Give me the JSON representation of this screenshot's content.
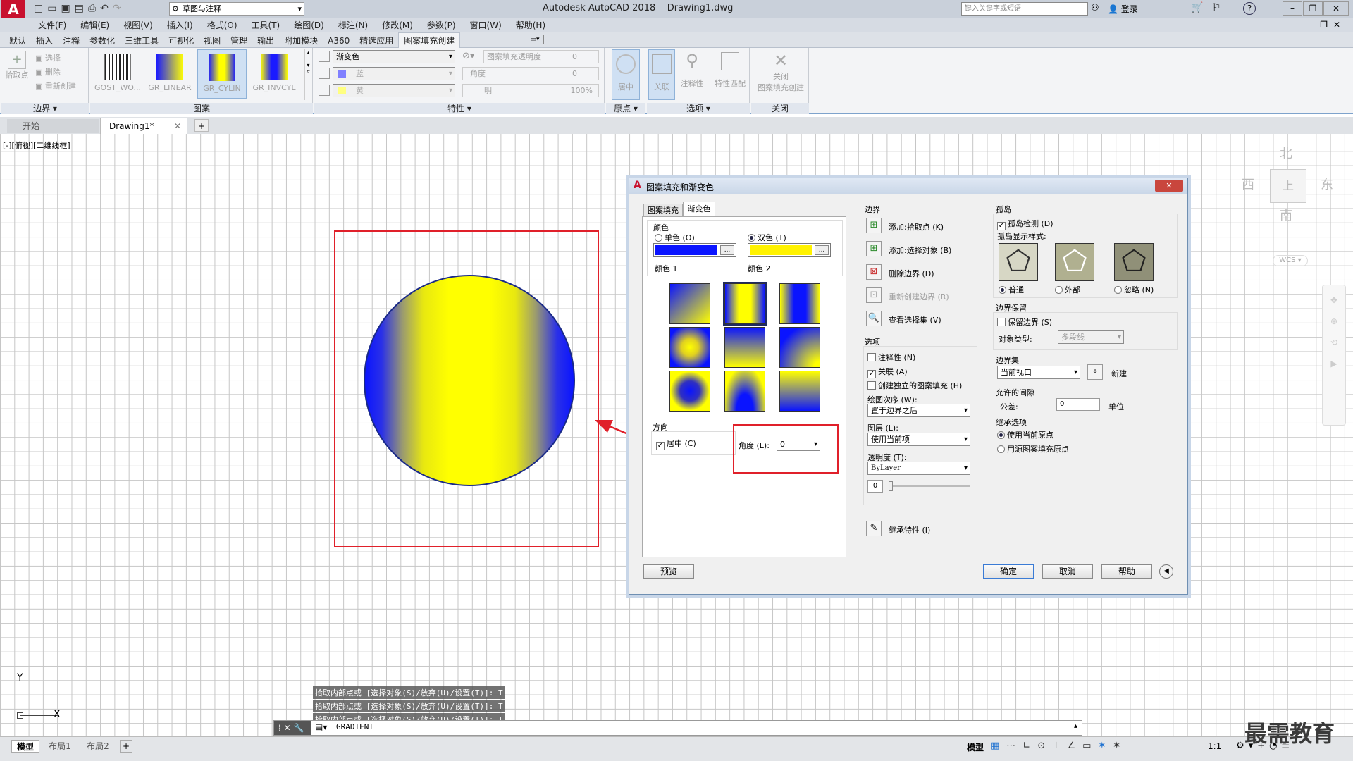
{
  "titlebar": {
    "app_title": "Autodesk AutoCAD 2018",
    "file_name": "Drawing1.dwg",
    "workspace": "草图与注释",
    "search_placeholder": "键入关键字或短语",
    "login": "登录"
  },
  "menubar": [
    "文件(F)",
    "编辑(E)",
    "视图(V)",
    "插入(I)",
    "格式(O)",
    "工具(T)",
    "绘图(D)",
    "标注(N)",
    "修改(M)",
    "参数(P)",
    "窗口(W)",
    "帮助(H)"
  ],
  "ribbon_tabs": [
    "默认",
    "插入",
    "注释",
    "参数化",
    "三维工具",
    "可视化",
    "视图",
    "管理",
    "输出",
    "附加模块",
    "A360",
    "精选应用",
    "图案填充创建"
  ],
  "ribbon": {
    "boundary": {
      "pick_points": "拾取点",
      "select": "选择",
      "remove": "删除",
      "recreate": "重新创建",
      "label": "边界"
    },
    "patterns": [
      "GOST_WO...",
      "GR_LINEAR",
      "GR_CYLIN",
      "GR_INVCYL"
    ],
    "pattern_label": "图案",
    "properties": {
      "type": "渐变色",
      "color1": "蓝",
      "color2": "黄",
      "transparency_label": "图案填充透明度",
      "transparency_value": "0",
      "angle_label": "角度",
      "angle_value": "0",
      "tint_label": "明",
      "tint_value": "100%",
      "label": "特性"
    },
    "origin": {
      "center": "居中",
      "label": "原点"
    },
    "options": {
      "associative": "关联",
      "annotative": "注释性",
      "match": "特性匹配",
      "label": "选项"
    },
    "close": {
      "btn1": "关闭",
      "btn2": "图案填充创建",
      "label": "关闭"
    }
  },
  "doc_tabs": {
    "start": "开始",
    "drawing": "Drawing1*"
  },
  "viewport_label": "[-][俯视][二维线框]",
  "viewcube": {
    "north": "北",
    "south": "南",
    "east": "东",
    "west": "西",
    "top": "上",
    "wcs": "WCS"
  },
  "dialog": {
    "title": "图案填充和渐变色",
    "tab_hatch": "图案填充",
    "tab_gradient": "渐变色",
    "color_section": "颜色",
    "one_color": "单色 (O)",
    "two_color": "双色 (T)",
    "color1_label": "颜色 1",
    "color2_label": "颜色 2",
    "color1_hex": "#0a14ff",
    "color2_hex": "#fff200",
    "browse": "...",
    "orientation_section": "方向",
    "centered": "居中 (C)",
    "angle_label": "角度 (L):",
    "angle_value": "0",
    "boundary_section": "边界",
    "add_pick_points": "添加:拾取点 (K)",
    "add_select_objects": "添加:选择对象 (B)",
    "remove_boundaries": "删除边界 (D)",
    "recreate_boundary": "重新创建边界 (R)",
    "view_selections": "查看选择集 (V)",
    "options_section": "选项",
    "annotative": "注释性 (N)",
    "associative": "关联 (A)",
    "create_separate": "创建独立的图案填充 (H)",
    "draw_order_label": "绘图次序 (W):",
    "draw_order_value": "置于边界之后",
    "layer_label": "图层 (L):",
    "layer_value": "使用当前项",
    "transparency_label": "透明度 (T):",
    "transparency_value": "ByLayer",
    "transparency_num": "0",
    "inherit_props": "继承特性 (I)",
    "islands_section": "孤岛",
    "island_detection": "孤岛检测 (D)",
    "island_style_label": "孤岛显示样式:",
    "island_normal": "普通",
    "island_outer": "外部",
    "island_ignore": "忽略 (N)",
    "retain_section": "边界保留",
    "retain_boundaries": "保留边界 (S)",
    "object_type_label": "对象类型:",
    "object_type_value": "多段线",
    "boundary_set_section": "边界集",
    "boundary_set_value": "当前视口",
    "new_label": "新建",
    "gap_section": "允许的间隙",
    "tolerance_label": "公差:",
    "tolerance_value": "0",
    "units": "单位",
    "inherit_section": "继承选项",
    "use_current_origin": "使用当前原点",
    "use_source_origin": "用源图案填充原点",
    "preview": "预览",
    "ok": "确定",
    "cancel": "取消",
    "help": "帮助"
  },
  "command": {
    "history": [
      "拾取内部点或 [选择对象(S)/放弃(U)/设置(T)]: T",
      "拾取内部点或 [选择对象(S)/放弃(U)/设置(T)]: T",
      "拾取内部点或 [选择对象(S)/放弃(U)/设置(T)]: T"
    ],
    "input": "GRADIENT"
  },
  "ucs": {
    "x": "X",
    "y": "Y"
  },
  "layout_tabs": [
    "模型",
    "布局1",
    "布局2"
  ],
  "status": {
    "model": "模型",
    "scale": "1:1"
  },
  "watermark": "最需教育"
}
